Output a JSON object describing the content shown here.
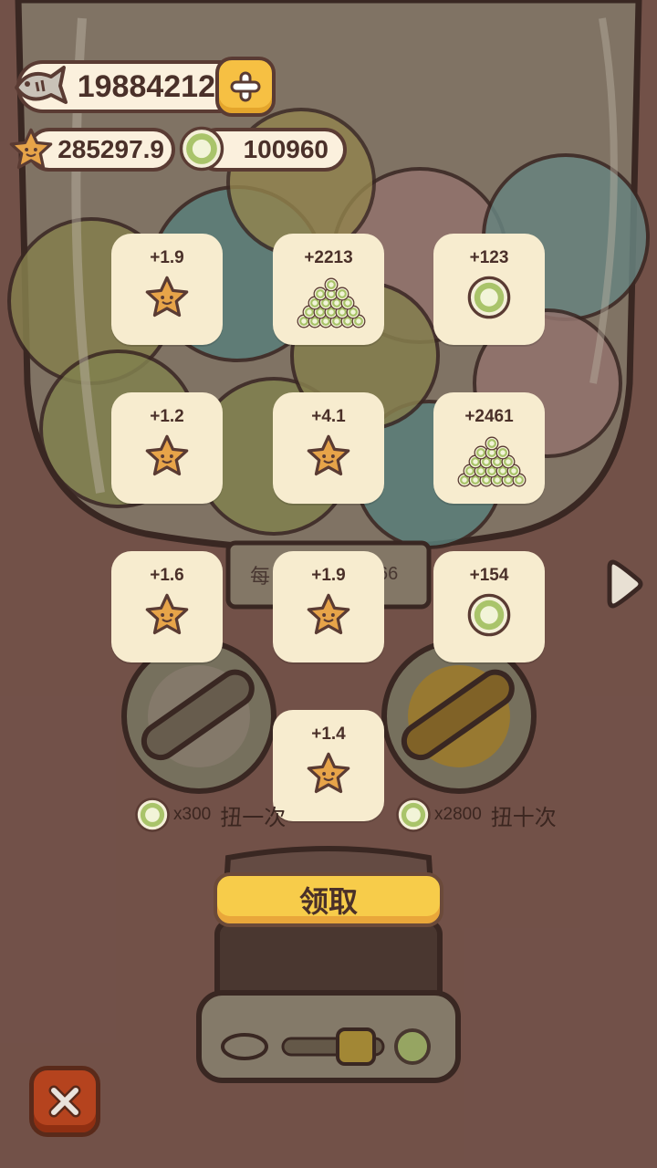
{
  "currencies": {
    "fish": "19884212",
    "stars": "285297.9",
    "coins": "100960"
  },
  "rewards": [
    {
      "amount": "+1.9",
      "icon": "star-icon"
    },
    {
      "amount": "+2213",
      "icon": "coin-pile-icon"
    },
    {
      "amount": "+123",
      "icon": "coin-icon"
    },
    {
      "amount": "+1.2",
      "icon": "star-icon"
    },
    {
      "amount": "+4.1",
      "icon": "star-icon"
    },
    {
      "amount": "+2461",
      "icon": "coin-pile-icon"
    },
    {
      "amount": "+1.6",
      "icon": "star-icon"
    },
    {
      "amount": "+1.9",
      "icon": "star-icon"
    },
    {
      "amount": "+154",
      "icon": "coin-icon"
    },
    {
      "amount": "+1.4",
      "icon": "star-icon"
    }
  ],
  "background_text": {
    "per_left": "每",
    "per_right": "66"
  },
  "spin_once": {
    "cost": "x300",
    "label": "扭一次"
  },
  "spin_ten": {
    "cost": "x2800",
    "label": "扭十次"
  },
  "claim_button": "领取",
  "colors": {
    "background": "#7a574e",
    "tile": "#f7eccf",
    "claim_button": "#f7cc4a",
    "close_button": "#b5431e",
    "star": "#e7a449",
    "coin": "#a9c46a"
  }
}
